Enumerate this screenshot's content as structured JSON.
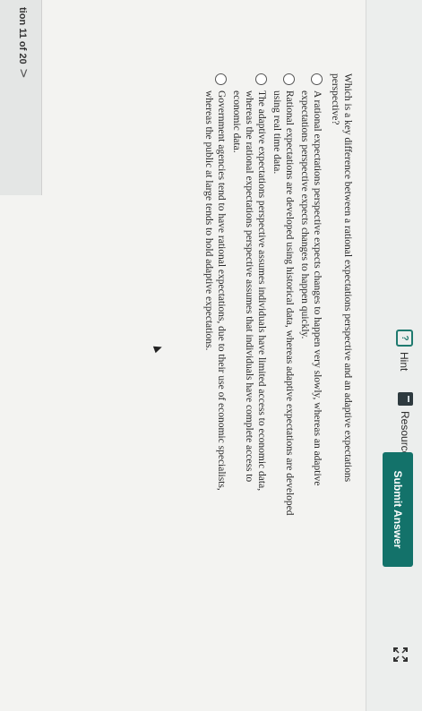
{
  "toolbar": {
    "resources_label": "Resources",
    "hint_label": "Hint",
    "submit_label": "Submit Answer"
  },
  "question_nav": {
    "label": "tion 11 of 20",
    "chevron": ">"
  },
  "question": {
    "prompt": "Which is a key difference between a rational expectations perspective and an adaptive expectations perspective?",
    "options": [
      "A rational expectations perspective expects changes to happen very slowly, whereas an adaptive expectations perspective expects changes to happen quickly.",
      "Rational expectations are developed using historical data, whereas adaptive expectations are developed using real time data.",
      "The adaptive expectations perspective assumes individuals have limited access to economic data, whereas the rational expectations perspective assumes that individuals have complete access to economic data.",
      "Government agencies tend to have rational expectations, due to their use of economic specialists, whereas the public at large tends to hold adaptive expectations."
    ]
  },
  "icons": {
    "resources": "resources-icon",
    "hint": "hint-icon",
    "expand": "expand-icon"
  },
  "colors": {
    "accent": "#13726a"
  }
}
